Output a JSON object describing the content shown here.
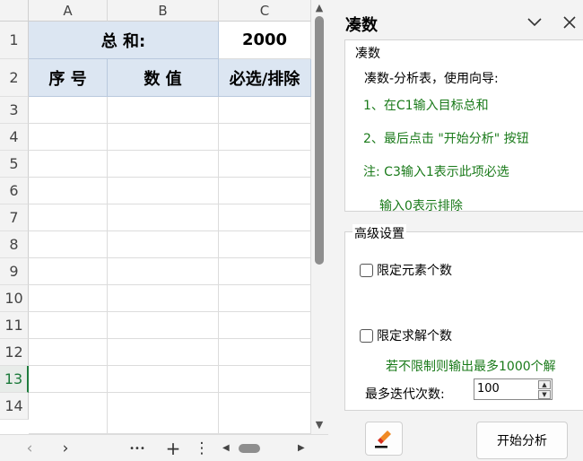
{
  "sheet": {
    "columns": [
      {
        "label": "A"
      },
      {
        "label": "B"
      },
      {
        "label": "C"
      }
    ],
    "rows": [
      "1",
      "2",
      "3",
      "4",
      "5",
      "6",
      "7",
      "8",
      "9",
      "10",
      "11",
      "12",
      "13",
      "14"
    ],
    "active_row": "13",
    "cells": {
      "sum_label": "总 和:",
      "sum_value": "2000",
      "header_seq": "序 号",
      "header_value": "数 值",
      "header_select": "必选/排除"
    }
  },
  "bottombar": {
    "prev_icon": "‹",
    "next_icon": "›",
    "more_icon": "•••",
    "add_icon": "+",
    "menu_icon": "⋮"
  },
  "pane": {
    "title": "凑数",
    "group1": {
      "legend": "凑数",
      "lines": [
        "凑数-分析表，使用向导:",
        "1、在C1输入目标总和",
        "2、最后点击 \"开始分析\" 按钮",
        "注:  C3输入1表示此项必选",
        "输入0表示排除"
      ]
    },
    "group2": {
      "legend": "高级设置",
      "limit_elements": "限定元素个数",
      "limit_solutions": "限定求解个数",
      "hint": "若不限制则输出最多1000个解",
      "max_iter_label": "最多迭代次数:",
      "max_iter_value": "100"
    },
    "start_button": "开始分析",
    "colors": {
      "accent_green": "#1a7a1a",
      "header_fill": "#dce6f2"
    }
  }
}
